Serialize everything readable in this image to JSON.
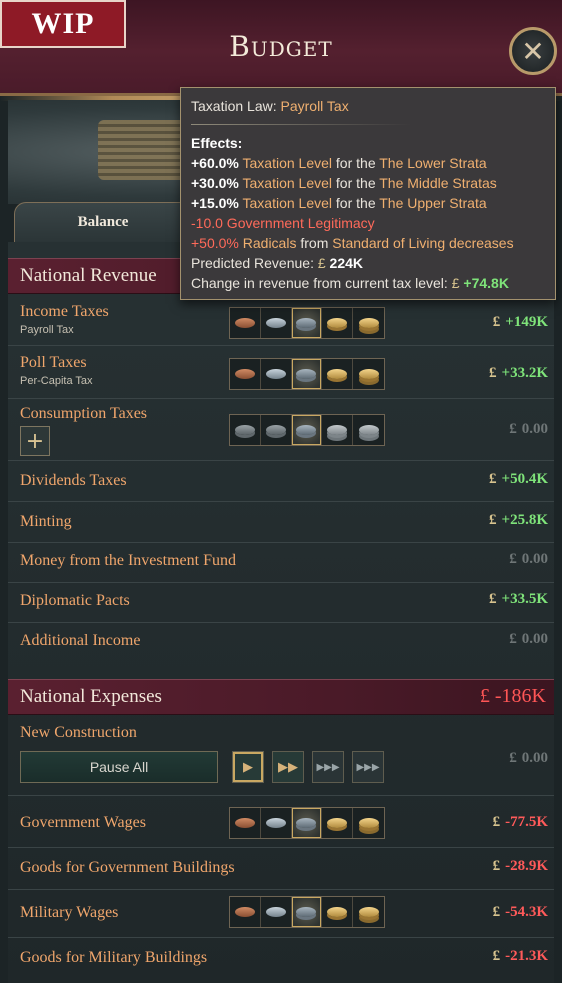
{
  "badge": "WIP",
  "title": "Budget",
  "close_icon": "close-icon",
  "tabs": [
    {
      "label": "Balance"
    }
  ],
  "currency": "£",
  "revenue": {
    "title": "National Revenue",
    "rows": [
      {
        "name": "Income Taxes",
        "sub": "Payroll Tax",
        "amount": "+149K"
      },
      {
        "name": "Poll Taxes",
        "sub": "Per-Capita Tax",
        "amount": "+33.2K"
      },
      {
        "name": "Consumption Taxes",
        "amount": "0.00"
      },
      {
        "name": "Dividends Taxes",
        "amount": "+50.4K"
      },
      {
        "name": "Minting",
        "amount": "+25.8K"
      },
      {
        "name": "Money from the Investment Fund",
        "amount": "0.00"
      },
      {
        "name": "Diplomatic Pacts",
        "amount": "+33.5K"
      },
      {
        "name": "Additional Income",
        "amount": "0.00"
      }
    ]
  },
  "expenses": {
    "title": "National Expenses",
    "total": "-186K",
    "pause_all": "Pause All",
    "rows": [
      {
        "name": "New Construction",
        "amount": "0.00"
      },
      {
        "name": "Government Wages",
        "amount": "-77.5K"
      },
      {
        "name": "Goods for Government Buildings",
        "amount": "-28.9K"
      },
      {
        "name": "Military Wages",
        "amount": "-54.3K"
      },
      {
        "name": "Goods for Military Buildings",
        "amount": "-21.3K"
      }
    ]
  },
  "tooltip": {
    "law_prefix": "Taxation Law: ",
    "law": "Payroll Tax",
    "effects_label": "Effects:",
    "e1_val": "+60.0%",
    "e1_a": "Taxation Level",
    "e1_b": " for the ",
    "e1_c": "The Lower Strata",
    "e2_val": "+30.0%",
    "e2_a": "Taxation Level",
    "e2_b": " for the ",
    "e2_c": "The Middle Stratas",
    "e3_val": "+15.0%",
    "e3_a": "Taxation Level",
    "e3_b": " for the ",
    "e3_c": "The Upper Strata",
    "e4": "-10.0 Government Legitimacy",
    "e5_val": "+50.0%",
    "e5_a": "Radicals",
    "e5_b": " from ",
    "e5_c": "Standard of Living",
    "e5_d": " decreases",
    "predicted_label": "Predicted Revenue: ",
    "predicted_value": "224K",
    "change_label": "Change in revenue from current tax level: ",
    "change_value": "+74.8K"
  }
}
